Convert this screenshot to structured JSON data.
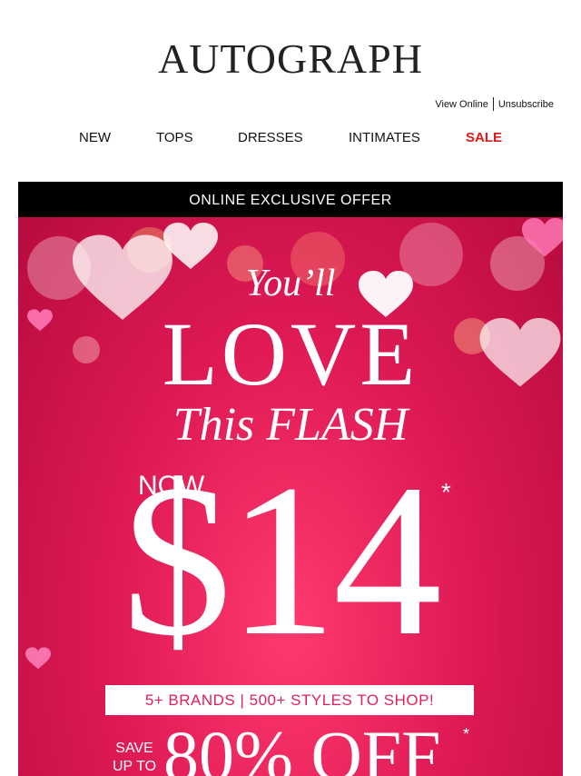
{
  "header": {
    "logo": "AUTOGRAPH",
    "view_online": "View Online",
    "unsubscribe": "Unsubscribe"
  },
  "nav": {
    "items": [
      {
        "label": "NEW"
      },
      {
        "label": "TOPS"
      },
      {
        "label": "DRESSES"
      },
      {
        "label": "INTIMATES"
      },
      {
        "label": "SALE",
        "color": "#e01a1a"
      }
    ]
  },
  "hero": {
    "banner": "ONLINE EXCLUSIVE OFFER",
    "line1": "You’ll",
    "line2": "LOVE",
    "line3": "This FLASH",
    "now": "NOW",
    "price": "$14",
    "price_asterisk": "*",
    "brands": "5+ BRANDS | 500+ STYLES TO SHOP!",
    "save_line1": "SAVE",
    "save_line2": "UP TO",
    "discount": "80% OFF",
    "discount_asterisk": "*",
    "colors": {
      "background": "#e01a55",
      "accent_text": "#e0205a",
      "banner": "#000000"
    }
  }
}
